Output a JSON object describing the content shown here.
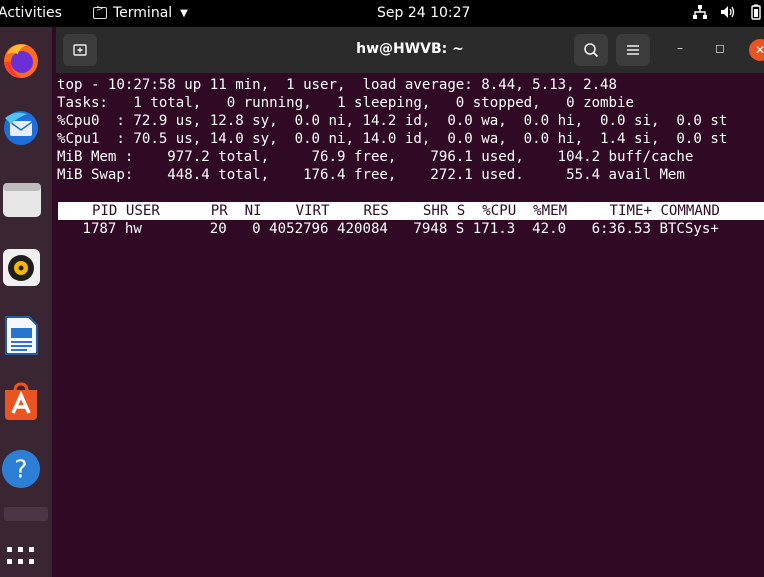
{
  "topbar": {
    "activities": "Activities",
    "app_name": "Terminal",
    "clock": "Sep 24  10:27"
  },
  "dock": {
    "items": [
      "firefox-icon",
      "thunderbird-icon",
      "files-icon",
      "rhythmbox-icon",
      "libreoffice-writer-icon",
      "app-center-icon",
      "help-icon",
      "show-apps-icon"
    ]
  },
  "window": {
    "title": "hw@HWVB: ~",
    "buttons": {
      "new_tab": "new-tab-icon",
      "search": "search-icon",
      "menu": "hamburger-menu-icon"
    },
    "minimize": "–",
    "maximize": "◻",
    "close": "✕"
  },
  "top": {
    "summary_line": "top - 10:27:58 up 11 min,  1 user,  load average: 8.44, 5.13, 2.48",
    "tasks_line": "Tasks:   1 total,   0 running,   1 sleeping,   0 stopped,   0 zombie",
    "cpu0_line": "%Cpu0  : 72.9 us, 12.8 sy,  0.0 ni, 14.2 id,  0.0 wa,  0.0 hi,  0.0 si,  0.0 st",
    "cpu1_line": "%Cpu1  : 70.5 us, 14.0 sy,  0.0 ni, 14.0 id,  0.0 wa,  0.0 hi,  1.4 si,  0.0 st",
    "mem_line": "MiB Mem :    977.2 total,     76.9 free,    796.1 used,    104.2 buff/cache",
    "swap_line": "MiB Swap:    448.4 total,    176.4 free,    272.1 used.     55.4 avail Mem",
    "header_line": "    PID USER      PR  NI    VIRT    RES    SHR S  %CPU  %MEM     TIME+ COMMAND",
    "rows": [
      "   1787 hw        20   0 4052796 420084   7948 S 171.3  42.0   6:36.53 BTCSys+"
    ]
  }
}
